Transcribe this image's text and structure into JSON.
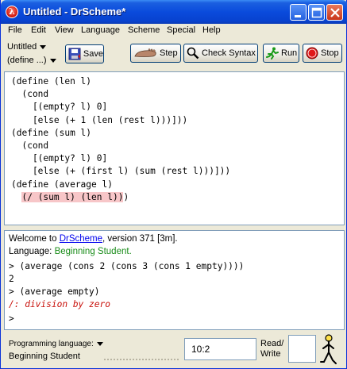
{
  "window": {
    "title": "Untitled - DrScheme*"
  },
  "menu": [
    "File",
    "Edit",
    "View",
    "Language",
    "Scheme",
    "Special",
    "Help"
  ],
  "toolbar": {
    "file_name": "Untitled",
    "define_label": "(define ...)",
    "save_label": "Save",
    "step_label": "Step",
    "check_syntax_label": "Check Syntax",
    "run_label": "Run",
    "stop_label": "Stop"
  },
  "definitions": {
    "lines": [
      "(define (len l)",
      "  (cond",
      "    [(empty? l) 0]",
      "    [else (+ 1 (len (rest l)))]))",
      "(define (sum l)",
      "  (cond",
      "    [(empty? l) 0]",
      "    [else (+ (first l) (sum (rest l)))]))",
      "(define (average l)"
    ],
    "last_line_indent": "  ",
    "last_line_highlighted": "(/ (sum l) (len l))",
    "last_line_rest": ")"
  },
  "interactions": {
    "welcome_prefix": "Welcome to ",
    "welcome_link": "DrScheme",
    "welcome_suffix": ", version 371 [3m].",
    "language_prefix": "Language: ",
    "language_name": "Beginning Student",
    "language_suffix": ".",
    "prompt": ">",
    "expr1": "(average (cons 2 (cons 3 (cons 1 empty))))",
    "result1": "2",
    "expr2": "(average empty)",
    "error": "/: division by zero"
  },
  "status": {
    "programming_language_label": "Programming language:",
    "language_value": "Beginning Student",
    "position": "10:2",
    "read_label": "Read/",
    "write_label": "Write"
  },
  "colors": {
    "title_bar": "#0a4bdc",
    "highlight": "#f7c6c8",
    "language_green": "#198c19",
    "error_red": "#c8100a",
    "link_blue": "#0000ee"
  }
}
